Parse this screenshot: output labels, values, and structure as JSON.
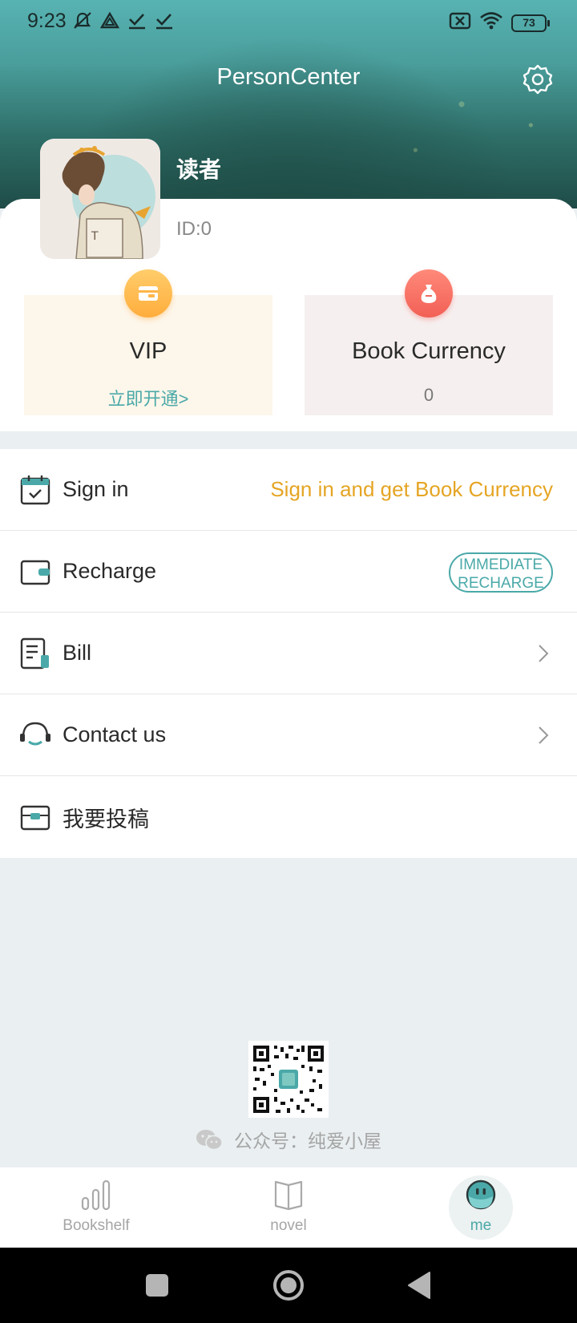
{
  "status_bar": {
    "time": "9:23",
    "battery": "73",
    "left_icons": [
      "mute-icon",
      "sync-icon",
      "check-icon",
      "check-icon"
    ],
    "right_icons": [
      "sim-off-icon",
      "wifi-icon",
      "battery-icon"
    ]
  },
  "header": {
    "title": "PersonCenter"
  },
  "profile": {
    "name": "读者",
    "id_label": "ID:0"
  },
  "stats": {
    "vip": {
      "title": "VIP",
      "sub": "立即开通>"
    },
    "currency": {
      "title": "Book Currency",
      "sub": "0"
    }
  },
  "menu": {
    "sign_in": {
      "label": "Sign in",
      "right_text": "Sign in and get Book Currency"
    },
    "recharge": {
      "label": "Recharge",
      "button_line1": "IMMEDIATE",
      "button_line2": "RECHARGE"
    },
    "bill": {
      "label": "Bill"
    },
    "contact": {
      "label": "Contact us"
    },
    "submit": {
      "label": "我要投稿"
    }
  },
  "footer": {
    "wechat_text": "公众号：纯爱小屋"
  },
  "bottom_nav": {
    "bookshelf": "Bookshelf",
    "novel": "novel",
    "me": "me"
  },
  "colors": {
    "accent": "#4aa9a8",
    "sign_in_highlight": "#e5a524",
    "vip_bg": "#fdf6ea",
    "currency_bg": "#f6efef"
  }
}
